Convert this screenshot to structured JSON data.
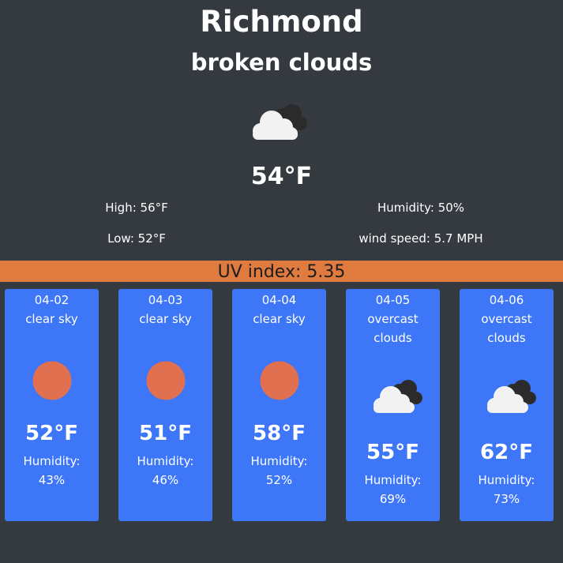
{
  "current": {
    "city": "Richmond",
    "description": "broken clouds",
    "icon": "broken-clouds-icon",
    "temperature": "54°F",
    "high": "High: 56°F",
    "low": "Low: 52°F",
    "humidity": "Humidity: 50%",
    "wind": "wind speed: 5.7 MPH"
  },
  "uv": {
    "label": "UV index: 5.35"
  },
  "forecast": [
    {
      "date": "04-02",
      "description": "clear sky",
      "icon": "sun-icon",
      "temperature": "52°F",
      "humidity_label": "Humidity:",
      "humidity": "43%"
    },
    {
      "date": "04-03",
      "description": "clear sky",
      "icon": "sun-icon",
      "temperature": "51°F",
      "humidity_label": "Humidity:",
      "humidity": "46%"
    },
    {
      "date": "04-04",
      "description": "clear sky",
      "icon": "sun-icon",
      "temperature": "58°F",
      "humidity_label": "Humidity:",
      "humidity": "52%"
    },
    {
      "date": "04-05",
      "description": "overcast clouds",
      "icon": "overcast-clouds-icon",
      "temperature": "55°F",
      "humidity_label": "Humidity:",
      "humidity": "69%"
    },
    {
      "date": "04-06",
      "description": "overcast clouds",
      "icon": "overcast-clouds-icon",
      "temperature": "62°F",
      "humidity_label": "Humidity:",
      "humidity": "73%"
    }
  ],
  "colors": {
    "background": "#343a40",
    "uv_bar": "#e07b3f",
    "card": "#3d76f7",
    "sun": "#e0704f"
  }
}
